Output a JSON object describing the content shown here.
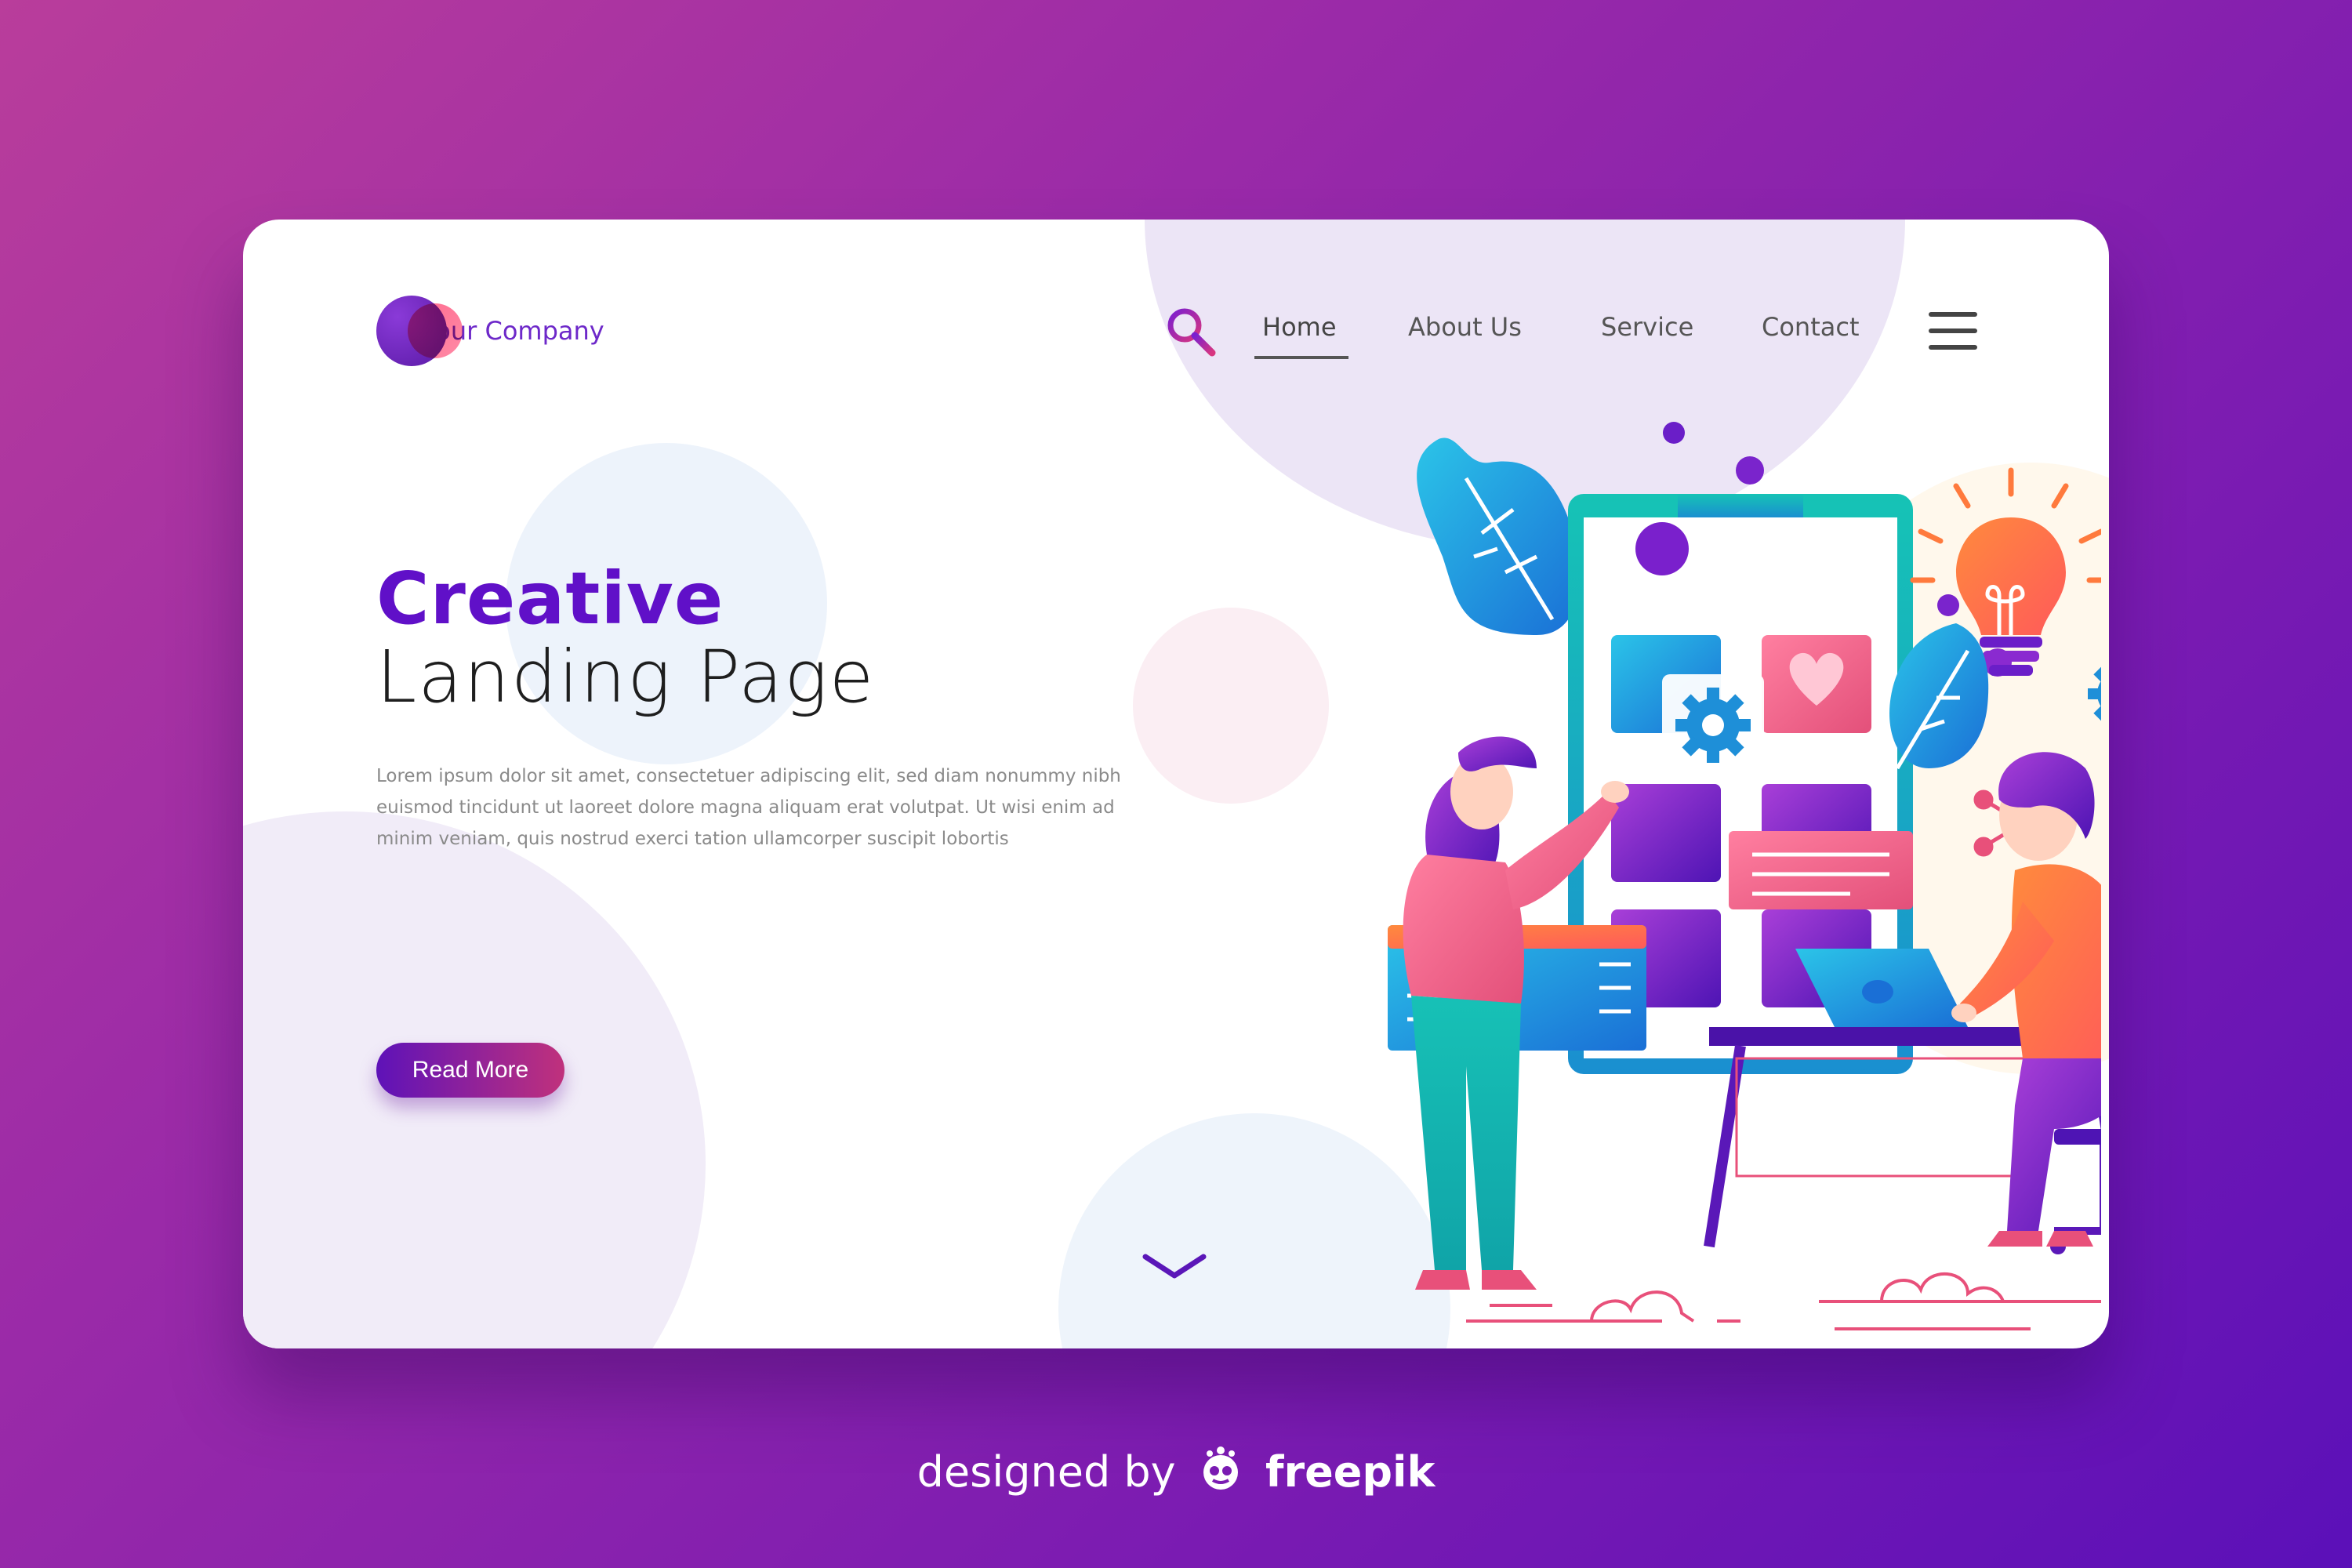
{
  "header": {
    "company": "Your Company"
  },
  "nav": {
    "items": [
      "Home",
      "About Us",
      "Service",
      "Contact"
    ],
    "active": "Home"
  },
  "hero": {
    "title_bold": "Creative",
    "title_light": "Landing Page",
    "body": "Lorem ipsum dolor sit amet, consectetuer adipiscing elit, sed diam nonummy nibh euismod tincidunt ut laoreet dolore magna aliquam erat volutpat. Ut wisi enim ad minim veniam, quis nostrud exerci tation ullamcorper suscipit lobortis",
    "button": "Read More"
  },
  "footer": {
    "prefix": "designed by",
    "brand": "freepik"
  },
  "icons": [
    "search-icon",
    "hamburger-menu-icon",
    "chevron-down-icon",
    "freepik-logo-icon"
  ],
  "colors": {
    "primary": "#6010c8",
    "accent": "#c0317c",
    "background_start": "#b93d9b",
    "background_end": "#5b10b8"
  }
}
